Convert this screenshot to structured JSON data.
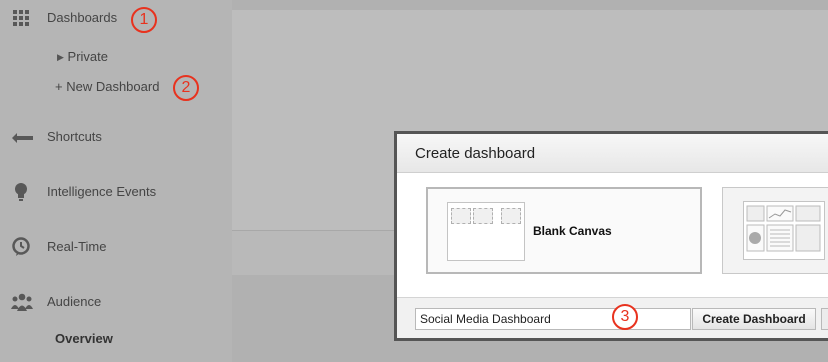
{
  "sidebar": {
    "items": [
      {
        "label": "Dashboards",
        "icon": "grid-icon"
      },
      {
        "label": "Shortcuts",
        "icon": "shortcut-arrow-icon"
      },
      {
        "label": "Intelligence Events",
        "icon": "lightbulb-icon"
      },
      {
        "label": "Real-Time",
        "icon": "clock-icon"
      },
      {
        "label": "Audience",
        "icon": "people-icon"
      }
    ],
    "private_label": "Private",
    "new_dashboard_label": "+ New Dashboard",
    "overview_label": "Overview"
  },
  "callouts": [
    "1",
    "2",
    "3"
  ],
  "dialog": {
    "title": "Create dashboard",
    "templates": [
      {
        "label": "Blank Canvas"
      },
      {
        "label": ""
      }
    ],
    "name_value": "Social Media Dashboard",
    "create_label": "Create Dashboard"
  },
  "colors": {
    "overlay": "#b1b1b1",
    "callout_red": "#e8321e",
    "dialog_border": "#555555"
  }
}
